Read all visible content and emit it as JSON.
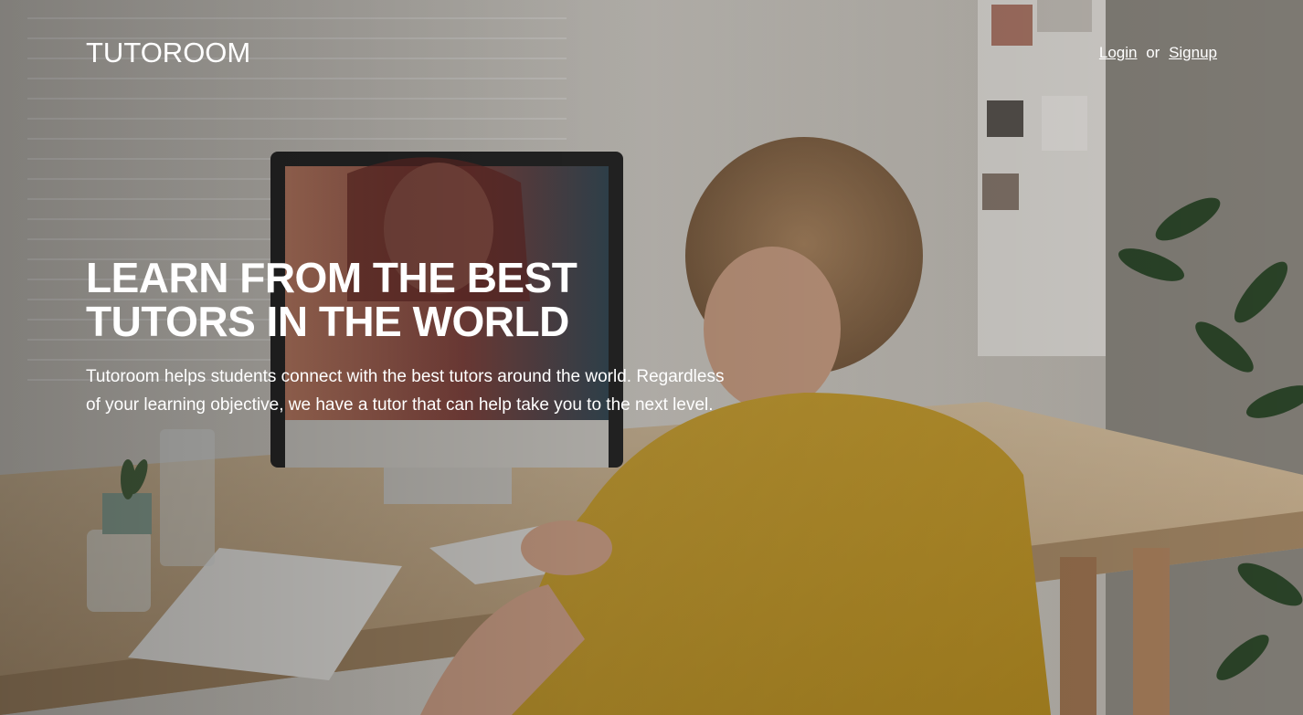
{
  "brand": {
    "logo": "TUTOROOM"
  },
  "nav": {
    "login_label": "Login",
    "separator": "or",
    "signup_label": "Signup"
  },
  "hero": {
    "headline_line1": "LEARN FROM THE BEST",
    "headline_line2": "TUTORS IN THE WORLD",
    "description": "Tutoroom helps students connect with the best tutors around the world. Regardless of your learning objective, we have a tutor that can help take you to the next level."
  },
  "colors": {
    "text": "#ffffff",
    "shirt": "#c9a23a",
    "desk": "#c9b08e",
    "wall": "#d6d2ca"
  }
}
